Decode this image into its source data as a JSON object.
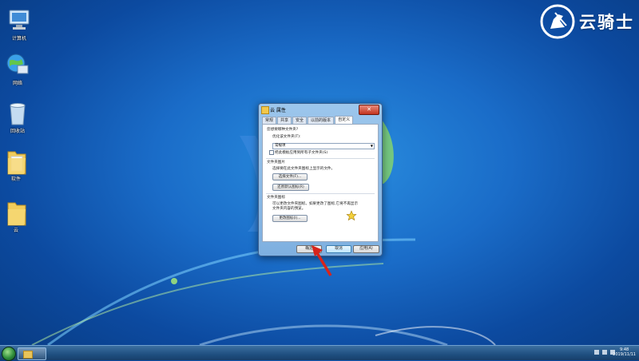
{
  "desktop": {
    "icons": [
      {
        "label": "计算机"
      },
      {
        "label": "网络"
      },
      {
        "label": "回收站"
      },
      {
        "label": "软件"
      },
      {
        "label": "云"
      }
    ]
  },
  "brand": {
    "text": "云骑士"
  },
  "dialog": {
    "title": "云 属性",
    "tabs": [
      "常规",
      "共享",
      "安全",
      "以前的版本",
      "自定义"
    ],
    "active_tab": "自定义",
    "section1_heading": "您想要哪种文件夹?",
    "optimize_label": "优化该文件夹(T):",
    "optimize_value": "常规项",
    "apply_subfolders_label": "把此模板应用到所有子文件夹(S)",
    "section2_heading": "文件夹图片",
    "section2_desc": "选择要在此文件夹图标上显示的文件。",
    "choose_file_button": "选择文件(F)...",
    "restore_default_button": "还原默认图标(R)",
    "section3_heading": "文件夹图标",
    "section3_desc_line1": "可以更改文件夹图标。如果更改了图标,它将不再显示",
    "section3_desc_line2": "文件夹内容的预览。",
    "change_icon_button": "更改图标(I)...",
    "ok_button": "确定",
    "cancel_button": "取消",
    "apply_button": "应用(A)"
  },
  "taskbar": {
    "clock_time": "9:48",
    "clock_date": "2019/11/11"
  },
  "colors": {
    "desktop_blue": "#1a6cc8",
    "annotation_arrow": "#d8241b",
    "taskbar": "#1f4f80"
  }
}
